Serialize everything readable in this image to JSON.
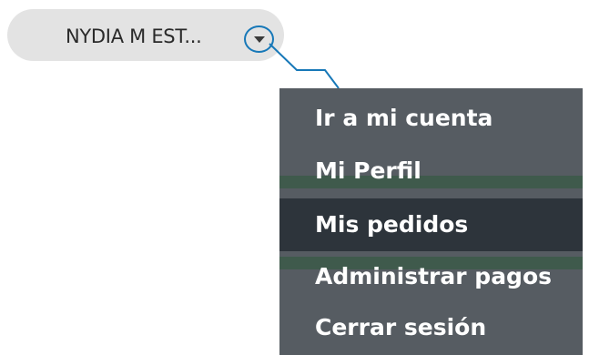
{
  "user": {
    "name": "NYDIA M EST..."
  },
  "menu": {
    "items": [
      {
        "label": "Ir a mi cuenta",
        "active": false
      },
      {
        "label": "Mi Perfil",
        "active": false
      },
      {
        "label": "Mis pedidos",
        "active": true
      },
      {
        "label": "Administrar pagos",
        "active": false
      },
      {
        "label": "Cerrar sesión",
        "active": false
      }
    ]
  },
  "icons": {
    "toggle": "chevron-down-icon"
  },
  "colors": {
    "pill": "#e3e3e3",
    "callout": "#1778b8",
    "menu_bg": "#565c62",
    "menu_active": "#2d343b",
    "menu_text": "#ffffff"
  }
}
